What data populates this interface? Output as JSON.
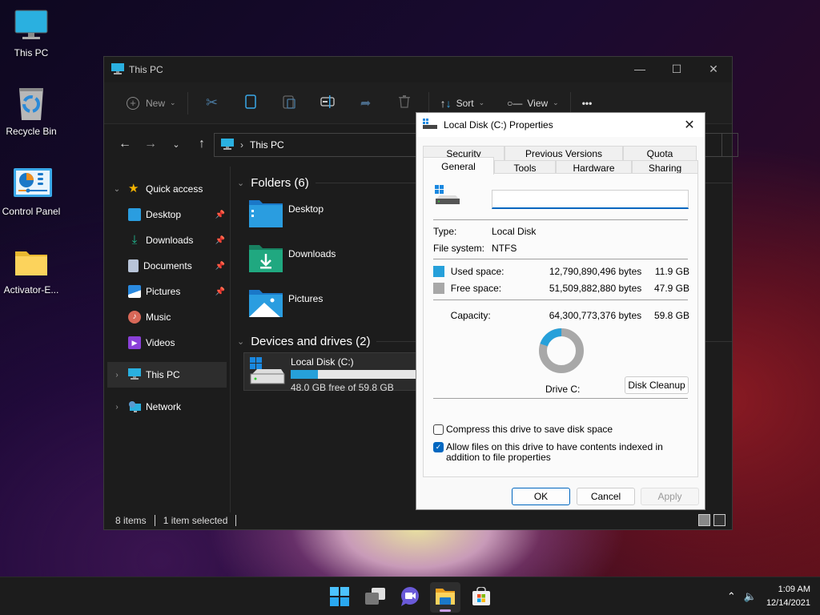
{
  "desktop": {
    "icons": [
      {
        "label": "This PC",
        "icon": "monitor-icon"
      },
      {
        "label": "Recycle Bin",
        "icon": "recycle-bin-icon"
      },
      {
        "label": "Control Panel",
        "icon": "control-panel-icon"
      },
      {
        "label": "Activator-E...",
        "icon": "folder-icon"
      }
    ]
  },
  "explorer": {
    "title": "This PC",
    "toolbar": {
      "new_label": "New",
      "sort_label": "Sort",
      "view_label": "View",
      "more_label": "•••"
    },
    "address": {
      "path": "This PC"
    },
    "sidebar": {
      "quick_access": "Quick access",
      "items": [
        {
          "label": "Desktop",
          "pinned": true
        },
        {
          "label": "Downloads",
          "pinned": true
        },
        {
          "label": "Documents",
          "pinned": true
        },
        {
          "label": "Pictures",
          "pinned": true
        },
        {
          "label": "Music",
          "pinned": false
        },
        {
          "label": "Videos",
          "pinned": false
        }
      ],
      "this_pc": "This PC",
      "network": "Network"
    },
    "content": {
      "folders_header": "Folders (6)",
      "folders": [
        {
          "label": "Desktop"
        },
        {
          "label": "Downloads"
        },
        {
          "label": "Pictures"
        }
      ],
      "drives_header": "Devices and drives (2)",
      "drive": {
        "name": "Local Disk (C:)",
        "free_text": "48.0 GB free of 59.8 GB",
        "used_fraction": 0.2
      }
    },
    "status": {
      "items": "8 items",
      "selected": "1 item selected"
    }
  },
  "dialog": {
    "title": "Local Disk (C:) Properties",
    "tabs_row1": [
      "Security",
      "Previous Versions",
      "Quota"
    ],
    "tabs_row2": [
      "General",
      "Tools",
      "Hardware",
      "Sharing"
    ],
    "active_tab": "General",
    "name_value": "",
    "type_label": "Type:",
    "type_value": "Local Disk",
    "fs_label": "File system:",
    "fs_value": "NTFS",
    "used_label": "Used space:",
    "used_bytes": "12,790,890,496 bytes",
    "used_gb": "11.9 GB",
    "free_label": "Free space:",
    "free_bytes": "51,509,882,880 bytes",
    "free_gb": "47.9 GB",
    "capacity_label": "Capacity:",
    "capacity_bytes": "64,300,773,376 bytes",
    "capacity_gb": "59.8 GB",
    "drive_label": "Drive C:",
    "used_fraction": 0.199,
    "colors": {
      "used": "#26a0da",
      "free": "#a8a8a8"
    },
    "disk_cleanup": "Disk Cleanup",
    "compress_label": "Compress this drive to save disk space",
    "compress_checked": false,
    "index_label": "Allow files on this drive to have contents indexed in addition to file properties",
    "index_checked": true,
    "ok": "OK",
    "cancel": "Cancel",
    "apply": "Apply"
  },
  "taskbar": {
    "apps": [
      "start",
      "task-view",
      "chat",
      "file-explorer",
      "store"
    ],
    "time": "1:09 AM",
    "date": "12/14/2021"
  }
}
